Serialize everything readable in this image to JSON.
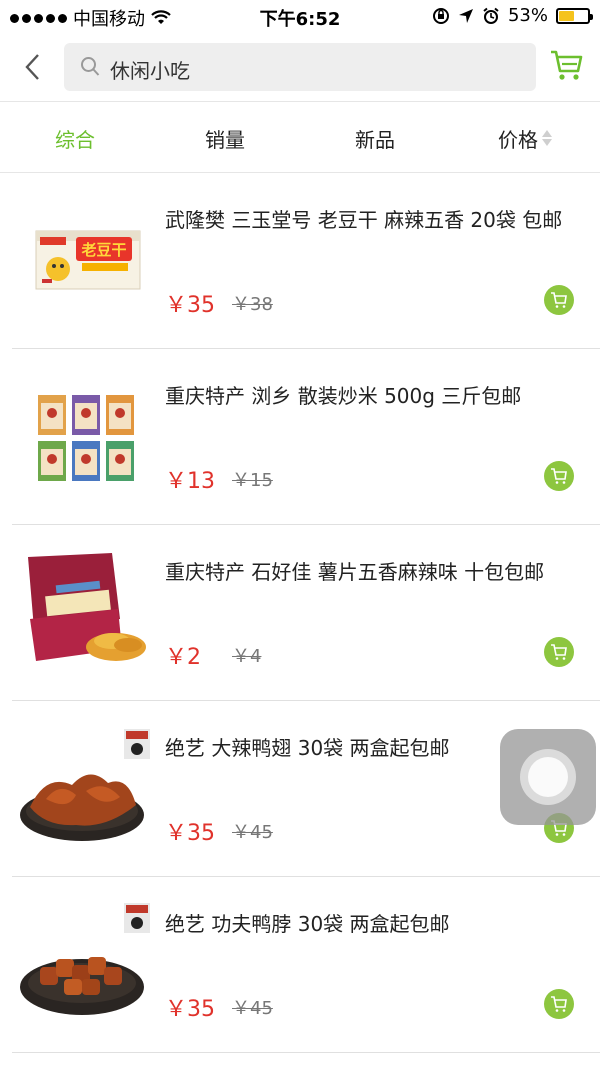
{
  "status_bar": {
    "carrier": "中国移动",
    "time": "下午6:52",
    "battery_percent": "53%",
    "battery_level": 0.53,
    "icons": [
      "signal-dots-icon",
      "wifi-icon",
      "rotation-lock-icon",
      "location-icon",
      "alarm-icon",
      "battery-icon"
    ]
  },
  "header": {
    "search_text": "休闲小吃",
    "icons": [
      "back-chevron-icon",
      "search-icon",
      "cart-icon"
    ]
  },
  "tabs": [
    {
      "label": "综合",
      "active": true
    },
    {
      "label": "销量",
      "active": false
    },
    {
      "label": "新品",
      "active": false
    },
    {
      "label": "价格",
      "active": false
    }
  ],
  "products": [
    {
      "title": "武隆樊 三玉堂号 老豆干 麻辣五香 20袋 包邮",
      "price": "￥35",
      "old_price": "￥38",
      "image": "tofu-snack-box"
    },
    {
      "title": "重庆特产 浏乡 散装炒米 500g  三斤包邮",
      "price": "￥13",
      "old_price": "￥15",
      "image": "fried-rice-packs"
    },
    {
      "title": "重庆特产 石好佳 薯片五香麻辣味 十包包邮",
      "price": "￥2",
      "old_price": "￥4",
      "image": "chips-bag"
    },
    {
      "title": "绝艺 大辣鸭翅 30袋 两盒起包邮",
      "price": "￥35",
      "old_price": "￥45",
      "image": "duck-wings"
    },
    {
      "title": "绝艺  功夫鸭脖 30袋 两盒起包邮",
      "price": "￥35",
      "old_price": "￥45",
      "image": "duck-neck"
    }
  ],
  "colors": {
    "accent_green": "#6cbf2e",
    "cart_badge_green": "#8dc63f",
    "price_red": "#e0322b",
    "battery_yellow": "#f5c31c"
  }
}
